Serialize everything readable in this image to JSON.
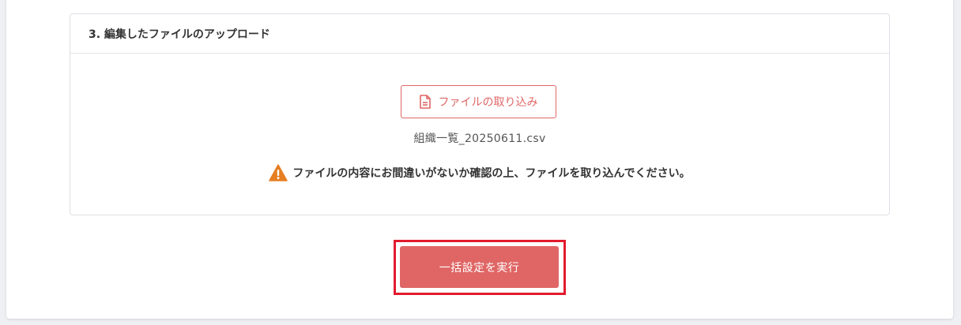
{
  "section": {
    "title": "3. 編集したファイルのアップロード"
  },
  "upload": {
    "import_label": "ファイルの取り込み",
    "import_icon": "file-icon",
    "file_name": "組織一覧_20250611.csv"
  },
  "warning": {
    "icon": "warning-icon",
    "message": "ファイルの内容にお間違いがないか確認の上、ファイルを取り込んでください。"
  },
  "actions": {
    "execute_label": "一括設定を実行"
  },
  "colors": {
    "accent": "#e06666",
    "highlight_border": "#e21b2e",
    "warning": "#e67e22"
  }
}
